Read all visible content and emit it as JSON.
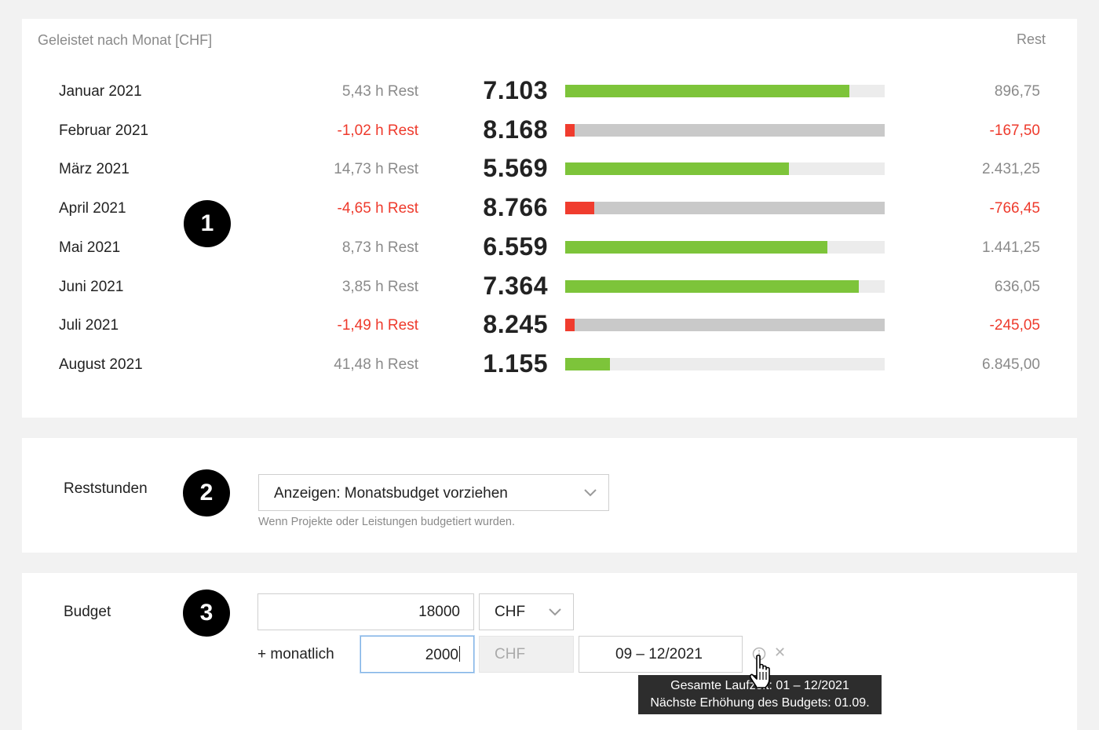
{
  "months_card": {
    "title": "Geleistet nach Monat [CHF]",
    "rest_header": "Rest",
    "rows": [
      {
        "month": "Januar 2021",
        "rest_hours": "5,43 h Rest",
        "value": "7.103",
        "bar_fill_pct": 89,
        "over_budget": false,
        "rest_amount": "896,75"
      },
      {
        "month": "Februar 2021",
        "rest_hours": "-1,02 h Rest",
        "value": "8.168",
        "bar_fill_pct": 3,
        "over_budget": true,
        "rest_amount": "-167,50"
      },
      {
        "month": "März 2021",
        "rest_hours": "14,73 h Rest",
        "value": "5.569",
        "bar_fill_pct": 70,
        "over_budget": false,
        "rest_amount": "2.431,25"
      },
      {
        "month": "April 2021",
        "rest_hours": "-4,65 h Rest",
        "value": "8.766",
        "bar_fill_pct": 9,
        "over_budget": true,
        "rest_amount": "-766,45"
      },
      {
        "month": "Mai 2021",
        "rest_hours": "8,73 h Rest",
        "value": "6.559",
        "bar_fill_pct": 82,
        "over_budget": false,
        "rest_amount": "1.441,25"
      },
      {
        "month": "Juni 2021",
        "rest_hours": "3,85 h Rest",
        "value": "7.364",
        "bar_fill_pct": 92,
        "over_budget": false,
        "rest_amount": "636,05"
      },
      {
        "month": "Juli 2021",
        "rest_hours": "-1,49 h Rest",
        "value": "8.245",
        "bar_fill_pct": 3,
        "over_budget": true,
        "rest_amount": "-245,05"
      },
      {
        "month": "August 2021",
        "rest_hours": "41,48 h Rest",
        "value": "1.155",
        "bar_fill_pct": 14,
        "over_budget": false,
        "rest_amount": "6.845,00"
      }
    ]
  },
  "badges": [
    "1",
    "2",
    "3"
  ],
  "reststunden": {
    "label": "Reststunden",
    "select_value": "Anzeigen: Monatsbudget vorziehen",
    "hint": "Wenn Projekte oder Leistungen budgetiert wurden."
  },
  "budget": {
    "label": "Budget",
    "amount": "18000",
    "currency": "CHF",
    "monthly_label": "+ monatlich",
    "monthly_amount": "2000",
    "monthly_currency": "CHF",
    "period": "09 – 12/2021",
    "tooltip_line1": "Gesamte Laufzeit: 01 – 12/2021",
    "tooltip_line2": "Nächste Erhöhung des Budgets: 01.09."
  },
  "colors": {
    "positive": "#7dc43a",
    "negative": "#f03c2e",
    "muted": "#8a8a8a"
  }
}
